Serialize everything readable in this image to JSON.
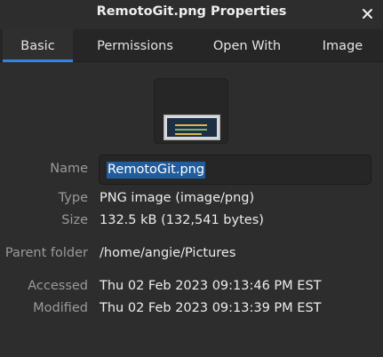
{
  "window": {
    "title": "RemotoGit.png Properties",
    "close_icon": "close-icon"
  },
  "tabs": [
    {
      "label": "Basic",
      "active": true
    },
    {
      "label": "Permissions",
      "active": false
    },
    {
      "label": "Open With",
      "active": false
    },
    {
      "label": "Image",
      "active": false
    }
  ],
  "basic": {
    "name_label": "Name",
    "name_value": "RemotoGit.png",
    "type_label": "Type",
    "type_value": "PNG image (image/png)",
    "size_label": "Size",
    "size_value": "132.5 kB (132,541 bytes)",
    "parent_label": "Parent folder",
    "parent_value": "/home/angie/Pictures",
    "accessed_label": "Accessed",
    "accessed_value": "Thu 02 Feb 2023 09:13:46 PM EST",
    "modified_label": "Modified",
    "modified_value": "Thu 02 Feb 2023 09:13:39 PM EST"
  },
  "colors": {
    "accent": "#3584e4",
    "selection": "#215d9c",
    "background": "#2d2d2d"
  }
}
